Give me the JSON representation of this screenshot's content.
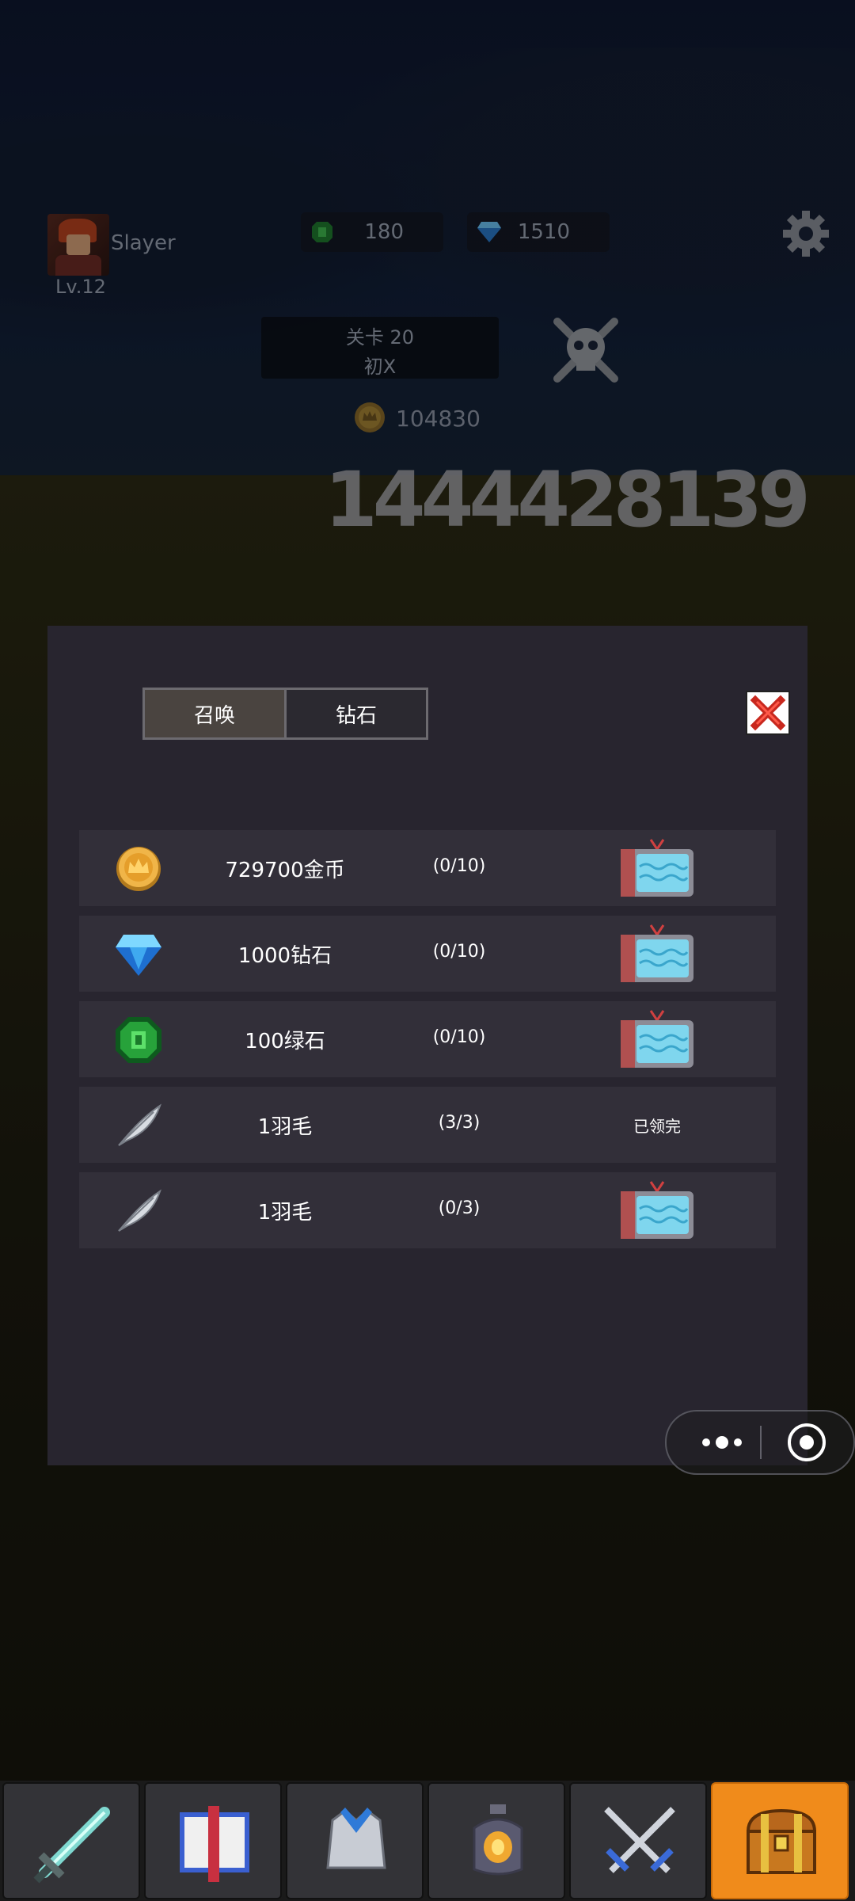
{
  "player": {
    "name": "Slayer",
    "level": "Lv.12"
  },
  "resources": {
    "green_stone": "180",
    "diamond": "1510"
  },
  "stage": {
    "line1": "关卡 20",
    "line2": "初X"
  },
  "gold": "104830",
  "damage_text": "1444428139",
  "panel": {
    "tabs": [
      {
        "label": "召唤",
        "active": true
      },
      {
        "label": "钻石",
        "active": false
      }
    ],
    "rows": [
      {
        "icon": "gold-coin-icon",
        "name": "729700金币",
        "count": "(0/10)",
        "action": "tv-ad-icon"
      },
      {
        "icon": "diamond-icon",
        "name": "1000钻石",
        "count": "(0/10)",
        "action": "tv-ad-icon"
      },
      {
        "icon": "green-stone-icon",
        "name": "100绿石",
        "count": "(0/10)",
        "action": "tv-ad-icon"
      },
      {
        "icon": "feather-icon",
        "name": "1羽毛",
        "count": "(3/3)",
        "status": "已领完"
      },
      {
        "icon": "feather-icon",
        "name": "1羽毛",
        "count": "(0/3)",
        "action": "tv-ad-icon"
      }
    ]
  },
  "bottom_nav": [
    {
      "icon": "sword-icon",
      "active": false
    },
    {
      "icon": "spellbook-icon",
      "active": false
    },
    {
      "icon": "armor-icon",
      "active": false
    },
    {
      "icon": "lantern-icon",
      "active": false
    },
    {
      "icon": "crossed-swords-icon",
      "active": false
    },
    {
      "icon": "treasure-chest-icon",
      "active": true
    }
  ],
  "colors": {
    "panel_bg": "#28252f",
    "row_bg": "#322f39",
    "active_nav": "#f08b1b"
  }
}
